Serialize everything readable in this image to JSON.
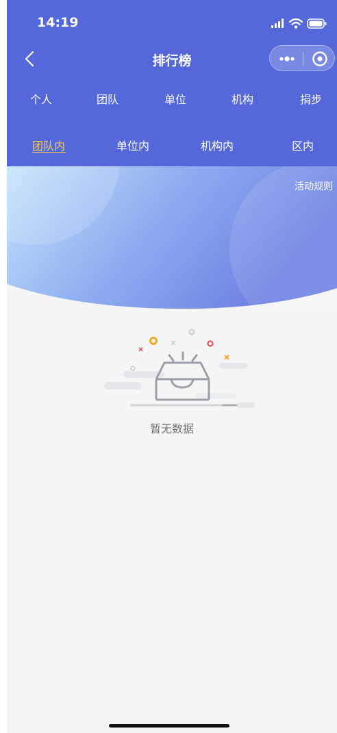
{
  "status_bar": {
    "time": "14:19"
  },
  "nav": {
    "title": "排行榜"
  },
  "tabs_primary": [
    {
      "label": "个人"
    },
    {
      "label": "团队"
    },
    {
      "label": "单位"
    },
    {
      "label": "机构"
    },
    {
      "label": "捐步"
    }
  ],
  "tabs_secondary": [
    {
      "label": "团队内",
      "active": true
    },
    {
      "label": "单位内"
    },
    {
      "label": "机构内"
    },
    {
      "label": "区内"
    }
  ],
  "banner": {
    "rules_link": "活动规则"
  },
  "empty_state": {
    "message": "暂无数据"
  },
  "colors": {
    "header_blue": "#5468d9",
    "active_tab": "#f3c65a",
    "background": "#f5f5f5"
  },
  "icons": [
    "back-arrow-icon",
    "more-dots-icon",
    "target-icon",
    "signal-icon",
    "wifi-icon",
    "battery-icon",
    "empty-box-icon"
  ]
}
